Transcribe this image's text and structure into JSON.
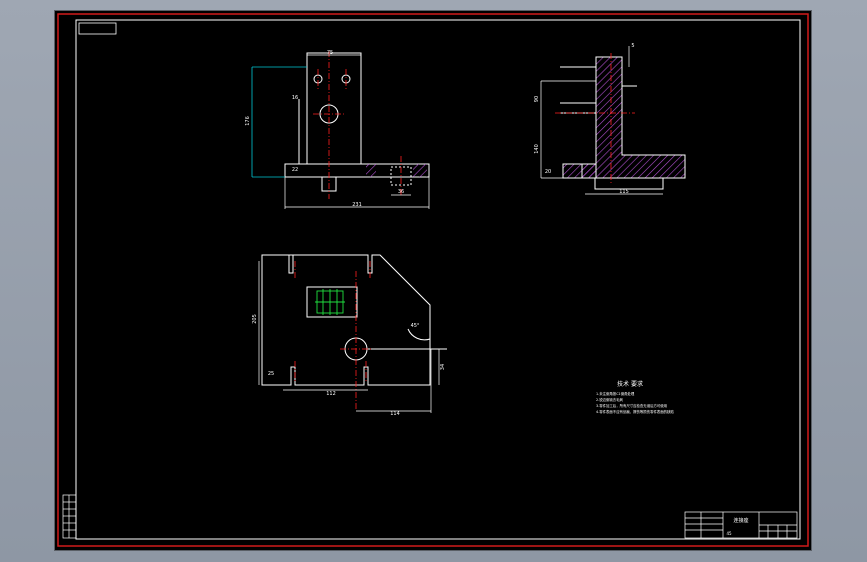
{
  "drawing": {
    "front_view": {
      "dim_top": "75",
      "dim_height": "176",
      "dim_bottom": "231",
      "dim_slot": "36",
      "dim_small_h": "16",
      "dim_side": "22"
    },
    "side_view": {
      "dim_upper": "90",
      "dim_lower": "140",
      "dim_base": "20",
      "dim_bottom": "115",
      "dim_top_tick": "5"
    },
    "top_view": {
      "dim_width": "205",
      "dim_left": "25",
      "dim_mid": "112",
      "dim_right": "114",
      "dim_small": "34",
      "dim_angle": "45°"
    },
    "tech_requirements": {
      "title": "技术 要求",
      "lines": [
        "1.未注倒角按C1倒角处理",
        "2.锐边倒钝去毛刺",
        "3.零件加工后，所有尺寸应检查无误后方可使用",
        "4.零件表面不应有划痕、擦伤等损伤零件表面的缺陷"
      ]
    },
    "title_block": {
      "part_name": "连接座",
      "material": "45"
    }
  },
  "colors": {
    "frame_red": "#d11a1a",
    "line_white": "#ffffff",
    "dim_cyan": "#00c8d6",
    "center_red": "#ff2020",
    "hatch_magenta": "#b050d0",
    "green": "#20e040"
  }
}
